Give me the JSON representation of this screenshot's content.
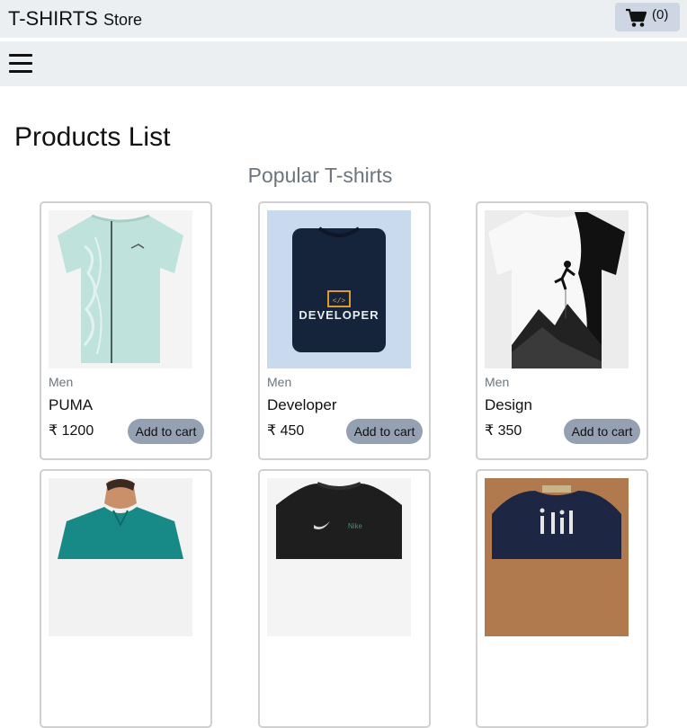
{
  "header": {
    "brand_main": "T-SHIRTS",
    "brand_sub": "Store",
    "cart_count": "(0)"
  },
  "main": {
    "title": "Products List",
    "subtitle": "Popular T-shirts"
  },
  "products": [
    {
      "category": "Men",
      "name": "PUMA",
      "price": "₹ 1200",
      "button": "Add to cart"
    },
    {
      "category": "Men",
      "name": "Developer",
      "price": "₹ 450",
      "button": "Add to cart"
    },
    {
      "category": "Men",
      "name": "Design",
      "price": "₹ 350",
      "button": "Add to cart"
    }
  ],
  "icons": {
    "cart": "shopping-cart-icon",
    "menu": "hamburger-menu-icon"
  },
  "colors": {
    "header_bg": "#eceff2",
    "cart_button_bg": "#cdd6e2",
    "add_button_bg": "#96a0b3",
    "muted_text": "#6c757d"
  }
}
